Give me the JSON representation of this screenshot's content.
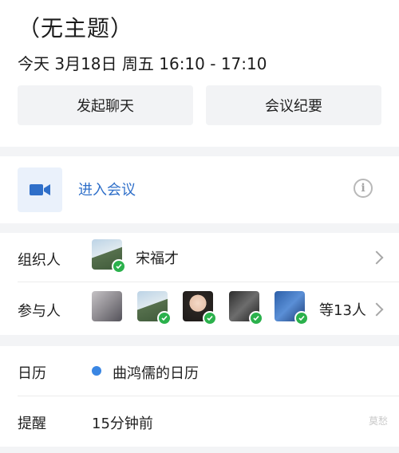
{
  "event": {
    "title": "（无主题）",
    "datetime": "今天 3月18日 周五 16:10 - 17:10"
  },
  "actions": {
    "start_chat": "发起聊天",
    "meeting_minutes": "会议纪要"
  },
  "meeting": {
    "join_label": "进入会议",
    "icon": "video-camera-icon",
    "info_icon": "info-icon",
    "info_glyph": "i"
  },
  "organizer": {
    "label": "组织人",
    "name": "宋福才"
  },
  "participants": {
    "label": "参与人",
    "count_text": "等13人"
  },
  "calendar": {
    "label": "日历",
    "name": "曲鸿儒的日历",
    "color": "#3a86e3"
  },
  "reminder": {
    "label": "提醒",
    "value": "15分钟前"
  },
  "watermark": "莫愁",
  "colors": {
    "accent": "#2f6fc9",
    "accepted_badge": "#2bb14c",
    "section_gap": "#f3f4f6"
  }
}
